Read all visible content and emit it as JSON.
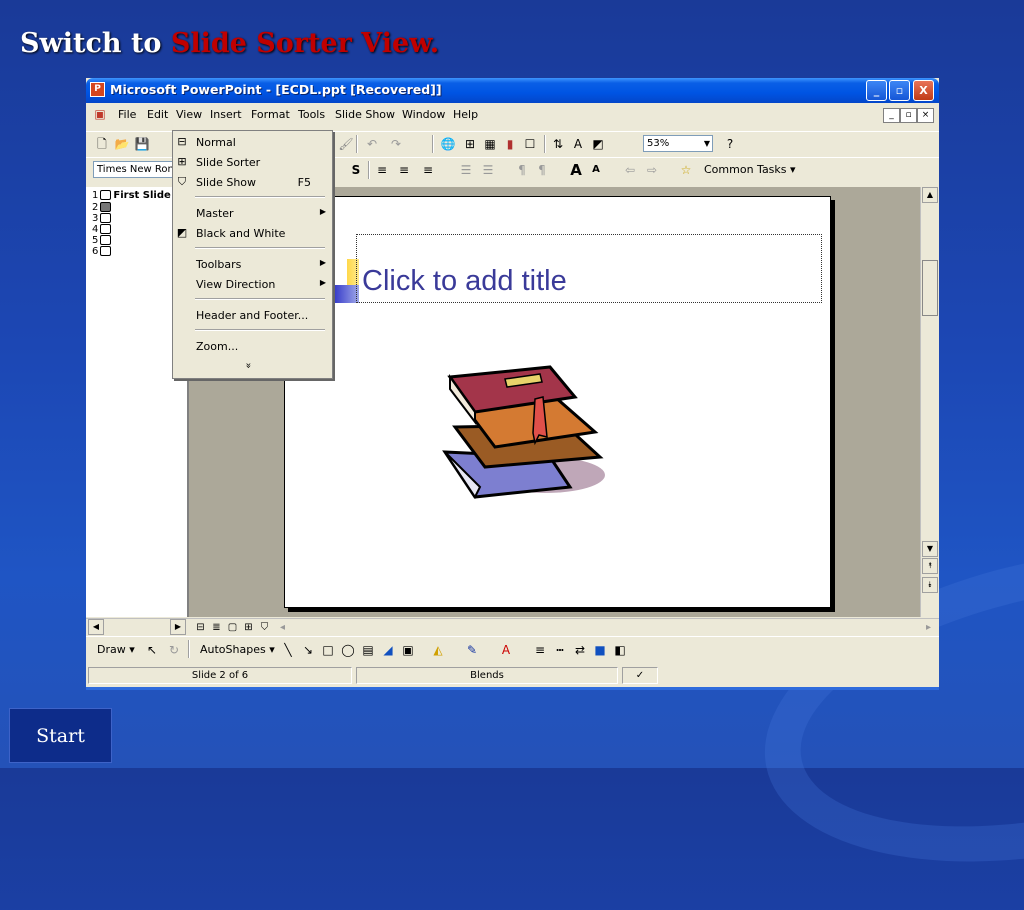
{
  "slide": {
    "heading_prefix": "Switch to ",
    "heading_highlight": "Slide Sorter View.",
    "start_label": "Start"
  },
  "window": {
    "title": "Microsoft PowerPoint - [ECDL.ppt [Recovered]]",
    "controls": {
      "minimize": "_",
      "maximize": "▫",
      "close": "X"
    },
    "doc_controls": {
      "minimize": "_",
      "restore": "▫",
      "close": "×"
    }
  },
  "menubar": {
    "items": [
      {
        "label": "File"
      },
      {
        "label": "Edit"
      },
      {
        "label": "View"
      },
      {
        "label": "Insert"
      },
      {
        "label": "Format"
      },
      {
        "label": "Tools"
      },
      {
        "label": "Slide Show"
      },
      {
        "label": "Window"
      },
      {
        "label": "Help"
      }
    ]
  },
  "toolbar": {
    "zoom": "53%",
    "font": "Times New Ron",
    "common_tasks": "Common Tasks ▾"
  },
  "view_menu": {
    "items": [
      {
        "label": "Normal",
        "icon": "normal-view-icon"
      },
      {
        "label": "Slide Sorter",
        "icon": "slide-sorter-icon"
      },
      {
        "label": "Slide Show",
        "shortcut": "F5",
        "icon": "slide-show-icon"
      },
      {
        "label": "Master",
        "submenu": true
      },
      {
        "label": "Black and White",
        "icon": "black-white-icon"
      },
      {
        "label": "Toolbars",
        "submenu": true
      },
      {
        "label": "View Direction",
        "submenu": true
      },
      {
        "label": "Header and Footer..."
      },
      {
        "label": "Zoom..."
      }
    ],
    "more": "»"
  },
  "outline": {
    "items": [
      {
        "num": "1",
        "text": "First Slide"
      },
      {
        "num": "2",
        "text": ""
      },
      {
        "num": "3",
        "text": ""
      },
      {
        "num": "4",
        "text": ""
      },
      {
        "num": "5",
        "text": ""
      },
      {
        "num": "6",
        "text": ""
      }
    ]
  },
  "slide_content": {
    "title_placeholder": "Click to add title"
  },
  "drawing": {
    "draw": "Draw ▾",
    "autoshapes": "AutoShapes ▾"
  },
  "status": {
    "slide": "Slide 2 of 6",
    "design": "Blends"
  }
}
